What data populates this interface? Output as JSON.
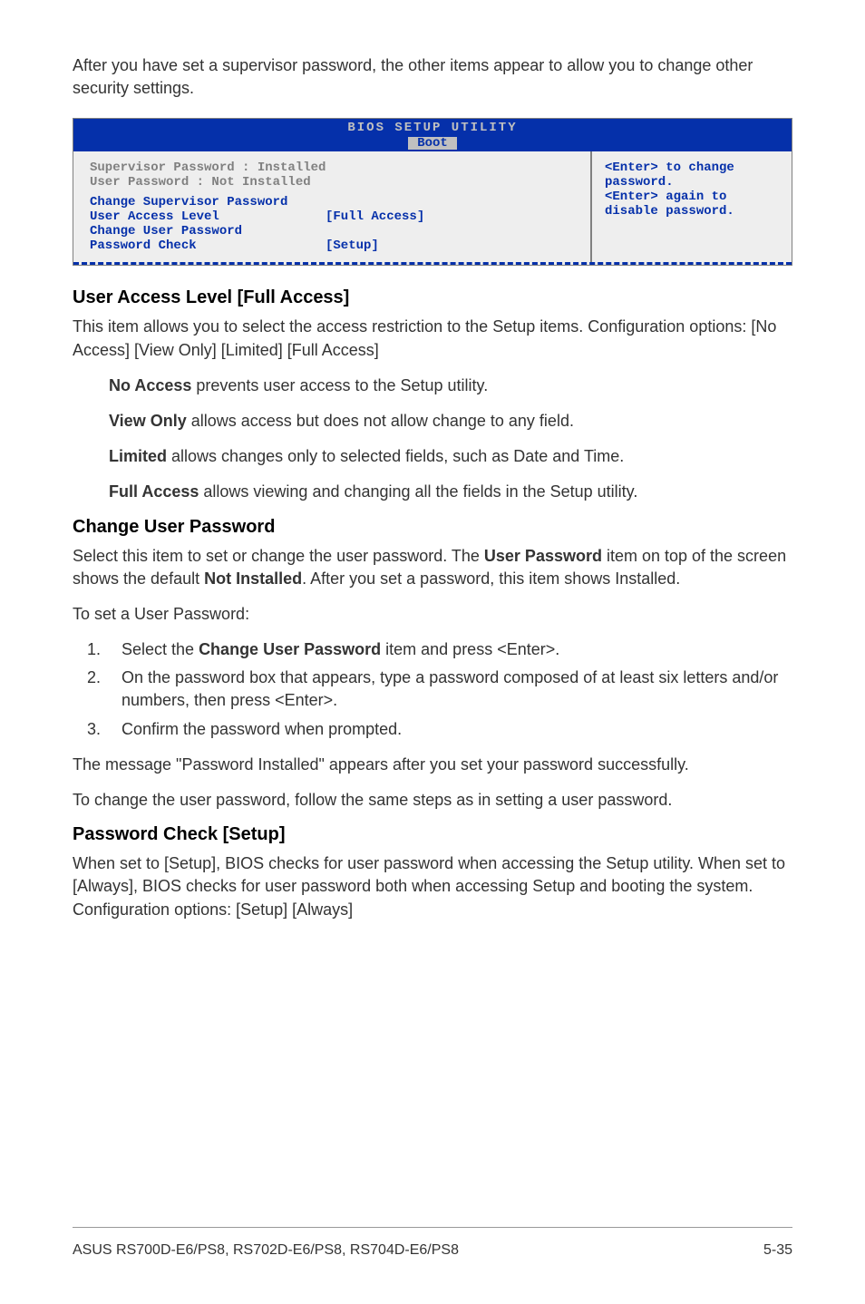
{
  "intro": "After you have set a supervisor password, the other items appear to allow you to change other security settings.",
  "bios": {
    "utilityTitle": "BIOS SETUP UTILITY",
    "tab": "Boot",
    "supervisorLabel": "Supervisor Password : Installed",
    "userLabel": "User Password       : Not Installed",
    "changeSupervisor": "Change Supervisor Password",
    "userAccessLevel": "User Access Level",
    "userAccessValue": "[Full Access]",
    "changeUser": "Change User Password",
    "passwordCheck": "Password Check",
    "passwordCheckValue": "[Setup]",
    "help1": "<Enter> to change password.",
    "help2": "<Enter> again to disable password."
  },
  "section1": {
    "heading": "User Access Level [Full Access]",
    "para": "This item allows you to select the access restriction to the Setup items. Configuration options: [No Access] [View Only] [Limited] [Full Access]",
    "defs": {
      "noAccessTerm": "No Access",
      "noAccess": " prevents user access to the Setup utility.",
      "viewOnlyTerm": "View Only",
      "viewOnly": " allows access but does not allow change to any field.",
      "limitedTerm": "Limited",
      "limited": " allows changes only to selected fields, such as Date and Time.",
      "fullAccessTerm": "Full Access",
      "fullAccess": " allows viewing and changing all the fields in the Setup utility."
    }
  },
  "section2": {
    "heading": "Change User Password",
    "para1a": "Select this item to set or change the user password. The ",
    "para1b": "User Password",
    "para1c": " item on top of the screen shows the default ",
    "para1d": "Not Installed",
    "para1e": ". After you set a password, this item shows Installed.",
    "para2": "To set a User Password:",
    "steps": {
      "s1a": "Select the ",
      "s1b": "Change User Password",
      "s1c": " item and press <Enter>.",
      "s2": "On the password box that appears, type a password composed of at least six letters and/or numbers, then press <Enter>.",
      "s3": "Confirm the password when prompted."
    },
    "para3": "The message \"Password Installed\" appears after you set your password successfully.",
    "para4": "To change the user password, follow the same steps as in setting a user password."
  },
  "section3": {
    "heading": "Password Check [Setup]",
    "para": "When set to [Setup], BIOS checks for user password when accessing the Setup utility. When set to [Always], BIOS checks for user password both when accessing Setup and booting the system. Configuration options: [Setup] [Always]"
  },
  "footer": {
    "left": "ASUS RS700D-E6/PS8, RS702D-E6/PS8, RS704D-E6/PS8",
    "right": "5-35"
  }
}
